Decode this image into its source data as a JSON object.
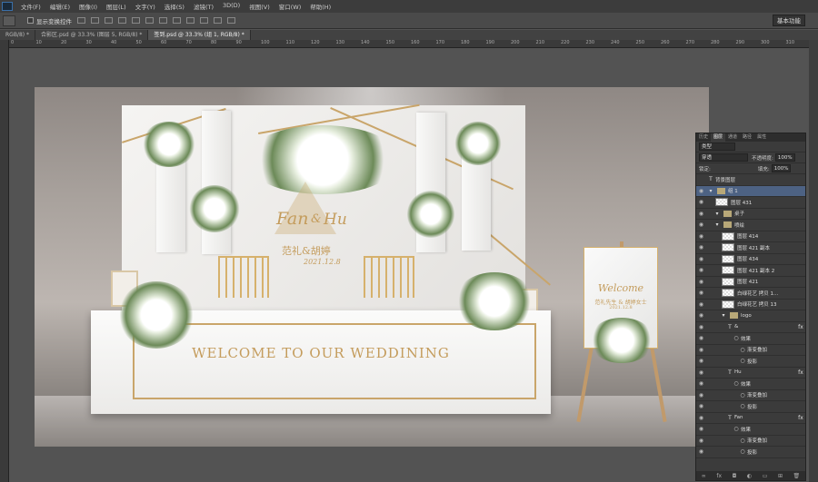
{
  "menu": {
    "logo": "Ps",
    "items": [
      "文件(F)",
      "编辑(E)",
      "图像(I)",
      "图层(L)",
      "文字(Y)",
      "选择(S)",
      "滤镜(T)",
      "3D(D)",
      "视图(V)",
      "窗口(W)",
      "帮助(H)"
    ]
  },
  "options": {
    "show_transform": "显示变换控件",
    "workspace": "基本功能"
  },
  "tabs": [
    {
      "label": "RGB/8) *",
      "active": false
    },
    {
      "label": "合影区.psd @ 33.3% (图层 5, RGB/8) *",
      "active": false
    },
    {
      "label": "签到.psd @ 33.3% (组 1, RGB/8) *",
      "active": true
    }
  ],
  "ruler_ticks": [
    "0",
    "10",
    "20",
    "30",
    "40",
    "50",
    "60",
    "70",
    "80",
    "90",
    "100",
    "110",
    "120",
    "130",
    "140",
    "150",
    "160",
    "170",
    "180",
    "190",
    "200",
    "210",
    "220",
    "230",
    "240",
    "250",
    "260",
    "270",
    "280",
    "290",
    "300",
    "310"
  ],
  "design": {
    "script_fan": "Fan",
    "script_amp": "&",
    "script_hu": "Hu",
    "names": "范礼&胡婷",
    "date": "2021.12.8",
    "table_welcome": "WELCOME TO OUR WEDDINING",
    "sign_welcome": "Welcome",
    "sign_names": "范礼先生 & 胡婷女士",
    "sign_date": "2021.12.8"
  },
  "layers_panel": {
    "tabs": [
      "历史",
      "图层",
      "通道",
      "路径",
      "属性"
    ],
    "active_tab": "图层",
    "kind_filter": "类型",
    "blend_mode": "穿透",
    "opacity_label": "不透明度:",
    "opacity": "100%",
    "lock_label": "锁定:",
    "fill_label": "填充:",
    "fill": "100%",
    "layers": [
      {
        "name": "背景图层",
        "type": "text",
        "visible": false,
        "indent": 0
      },
      {
        "name": "组 1",
        "type": "group",
        "visible": true,
        "indent": 0,
        "active": true
      },
      {
        "name": "图层 431",
        "type": "pixel",
        "visible": true,
        "indent": 1
      },
      {
        "name": "桌子",
        "type": "group",
        "visible": true,
        "indent": 1
      },
      {
        "name": "喷绘",
        "type": "group",
        "visible": true,
        "indent": 1
      },
      {
        "name": "图层 414",
        "type": "pixel",
        "visible": true,
        "indent": 2
      },
      {
        "name": "图层 421 副本",
        "type": "pixel",
        "visible": true,
        "indent": 2
      },
      {
        "name": "图层 434",
        "type": "pixel",
        "visible": true,
        "indent": 2
      },
      {
        "name": "图层 421 副本 2",
        "type": "pixel",
        "visible": true,
        "indent": 2
      },
      {
        "name": "图层 421",
        "type": "pixel",
        "visible": true,
        "indent": 2
      },
      {
        "name": "白绿花艺 拷贝 1...",
        "type": "pixel",
        "visible": true,
        "indent": 2
      },
      {
        "name": "白绿花艺 拷贝 13",
        "type": "pixel",
        "visible": true,
        "indent": 2
      },
      {
        "name": "logo",
        "type": "group",
        "visible": true,
        "indent": 2
      },
      {
        "name": "&",
        "type": "text",
        "visible": true,
        "indent": 3,
        "fx": true
      },
      {
        "name": "效果",
        "type": "effect",
        "visible": true,
        "indent": 4
      },
      {
        "name": "渐变叠加",
        "type": "effect",
        "visible": true,
        "indent": 5
      },
      {
        "name": "投影",
        "type": "effect",
        "visible": true,
        "indent": 5
      },
      {
        "name": "Hu",
        "type": "text",
        "visible": true,
        "indent": 3,
        "fx": true
      },
      {
        "name": "效果",
        "type": "effect",
        "visible": true,
        "indent": 4
      },
      {
        "name": "渐变叠加",
        "type": "effect",
        "visible": true,
        "indent": 5
      },
      {
        "name": "投影",
        "type": "effect",
        "visible": true,
        "indent": 5
      },
      {
        "name": "Fan",
        "type": "text",
        "visible": true,
        "indent": 3,
        "fx": true
      },
      {
        "name": "效果",
        "type": "effect",
        "visible": true,
        "indent": 4
      },
      {
        "name": "渐变叠加",
        "type": "effect",
        "visible": true,
        "indent": 5
      },
      {
        "name": "投影",
        "type": "effect",
        "visible": true,
        "indent": 5
      }
    ],
    "footer_icons": [
      "link-icon",
      "fx-icon",
      "mask-icon",
      "adjustment-icon",
      "folder-icon",
      "new-layer-icon",
      "trash-icon"
    ],
    "footer_glyphs": [
      "∞",
      "fx",
      "◘",
      "◐",
      "▭",
      "⊞",
      "🗑"
    ]
  }
}
